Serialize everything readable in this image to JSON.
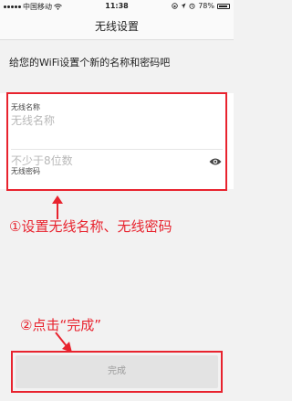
{
  "status": {
    "carrier": "中国移动",
    "time": "11:38",
    "battery": "78%"
  },
  "nav": {
    "title": "无线设置"
  },
  "subtitle": "给您的WiFi设置个新的名称和密码吧",
  "form": {
    "name_label": "无线名称",
    "name_placeholder": "无线名称",
    "password_label": "无线密码",
    "password_placeholder": "不少于8位数"
  },
  "annotations": {
    "step1": "①设置无线名称、无线密码",
    "step2": "②点击“完成”"
  },
  "done_label": "完成",
  "colors": {
    "annotation": "#e8232e"
  }
}
